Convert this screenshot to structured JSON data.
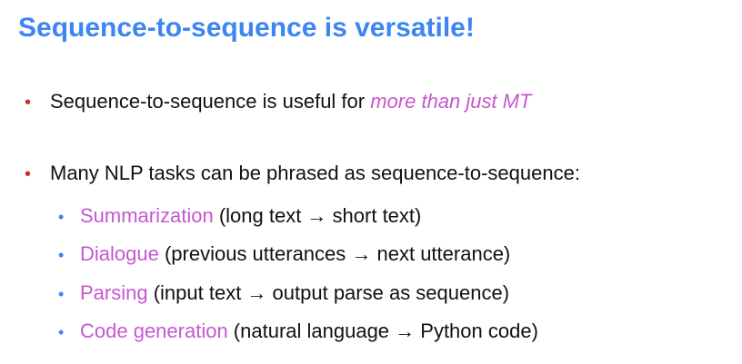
{
  "title": "Sequence-to-sequence is versatile!",
  "colors": {
    "title": "#3d85f0",
    "bullet": "#d42a2a",
    "sub_bullet": "#3d85f0",
    "accent": "#c458d0",
    "text": "#111111"
  },
  "bullets": [
    {
      "text": "Sequence-to-sequence is useful for ",
      "emphasis": "more than just MT"
    },
    {
      "text": "Many NLP tasks can be phrased as sequence-to-sequence:"
    }
  ],
  "sub_bullets": [
    {
      "term": "Summarization",
      "desc": " (long text → short text)"
    },
    {
      "term": "Dialogue",
      "desc": " (previous utterances → next utterance)"
    },
    {
      "term": "Parsing",
      "desc": " (input text → output parse as sequence)"
    },
    {
      "term": "Code generation",
      "desc": " (natural language → Python code)"
    }
  ]
}
